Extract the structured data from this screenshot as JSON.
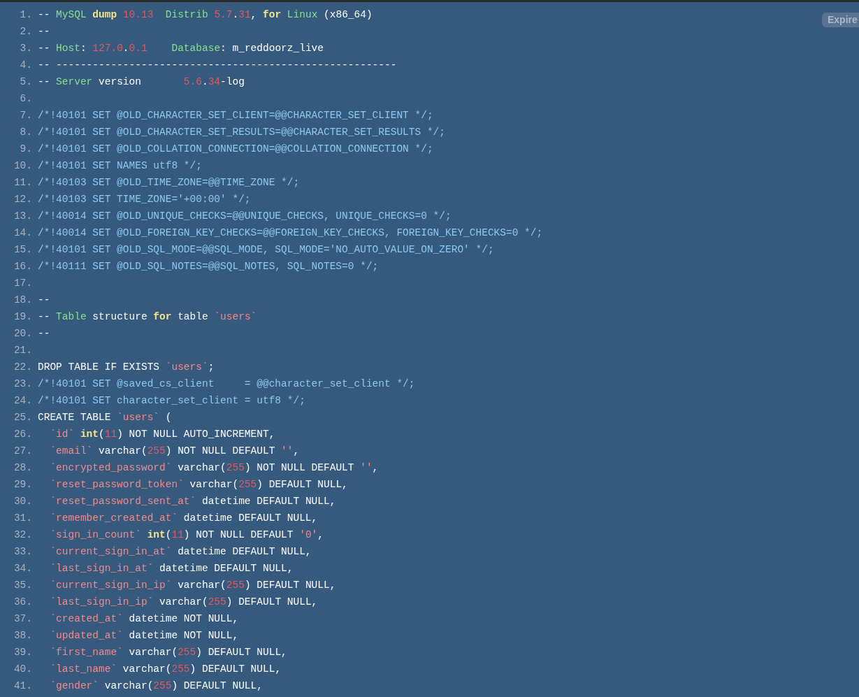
{
  "badge": "Expire",
  "lines": [
    {
      "number": "1.",
      "tokens": [
        {
          "kind": "plain",
          "text": "-- "
        },
        {
          "kind": "comment",
          "text": "MySQL "
        },
        {
          "kind": "keyword",
          "text": "dump "
        },
        {
          "kind": "number",
          "text": "10.13  "
        },
        {
          "kind": "comment",
          "text": "Distrib "
        },
        {
          "kind": "number",
          "text": "5.7"
        },
        {
          "kind": "plain",
          "text": "."
        },
        {
          "kind": "number",
          "text": "31"
        },
        {
          "kind": "plain",
          "text": ", "
        },
        {
          "kind": "keyword",
          "text": "for "
        },
        {
          "kind": "comment",
          "text": "Linux"
        },
        {
          "kind": "plain",
          "text": " (x86_64)"
        }
      ]
    },
    {
      "number": "2.",
      "tokens": [
        {
          "kind": "plain",
          "text": "--"
        }
      ]
    },
    {
      "number": "3.",
      "tokens": [
        {
          "kind": "plain",
          "text": "-- "
        },
        {
          "kind": "comment",
          "text": "Host"
        },
        {
          "kind": "plain",
          "text": ": "
        },
        {
          "kind": "number",
          "text": "127.0"
        },
        {
          "kind": "plain",
          "text": "."
        },
        {
          "kind": "number",
          "text": "0.1    "
        },
        {
          "kind": "comment",
          "text": "Database"
        },
        {
          "kind": "plain",
          "text": ": m_reddoorz_live"
        }
      ]
    },
    {
      "number": "4.",
      "tokens": [
        {
          "kind": "plain",
          "text": "-- --------------------------------------------------------"
        }
      ]
    },
    {
      "number": "5.",
      "tokens": [
        {
          "kind": "plain",
          "text": "-- "
        },
        {
          "kind": "comment",
          "text": "Server"
        },
        {
          "kind": "plain",
          "text": " version       "
        },
        {
          "kind": "number",
          "text": "5.6"
        },
        {
          "kind": "plain",
          "text": "."
        },
        {
          "kind": "number",
          "text": "34"
        },
        {
          "kind": "plain",
          "text": "-log"
        }
      ]
    },
    {
      "number": "6."
    },
    {
      "number": "7.",
      "tokens": [
        {
          "kind": "directive",
          "text": "/*!40101 SET @OLD_CHARACTER_SET_CLIENT=@@CHARACTER_SET_CLIENT */;"
        }
      ]
    },
    {
      "number": "8.",
      "tokens": [
        {
          "kind": "directive",
          "text": "/*!40101 SET @OLD_CHARACTER_SET_RESULTS=@@CHARACTER_SET_RESULTS */;"
        }
      ]
    },
    {
      "number": "9.",
      "tokens": [
        {
          "kind": "directive",
          "text": "/*!40101 SET @OLD_COLLATION_CONNECTION=@@COLLATION_CONNECTION */;"
        }
      ]
    },
    {
      "number": "10.",
      "tokens": [
        {
          "kind": "directive",
          "text": "/*!40101 SET NAMES utf8 */;"
        }
      ]
    },
    {
      "number": "11.",
      "tokens": [
        {
          "kind": "directive",
          "text": "/*!40103 SET @OLD_TIME_ZONE=@@TIME_ZONE */;"
        }
      ]
    },
    {
      "number": "12.",
      "tokens": [
        {
          "kind": "directive",
          "text": "/*!40103 SET TIME_ZONE='+00:00' */;"
        }
      ]
    },
    {
      "number": "13.",
      "tokens": [
        {
          "kind": "directive",
          "text": "/*!40014 SET @OLD_UNIQUE_CHECKS=@@UNIQUE_CHECKS, UNIQUE_CHECKS=0 */;"
        }
      ]
    },
    {
      "number": "14.",
      "tokens": [
        {
          "kind": "directive",
          "text": "/*!40014 SET @OLD_FOREIGN_KEY_CHECKS=@@FOREIGN_KEY_CHECKS, FOREIGN_KEY_CHECKS=0 */;"
        }
      ]
    },
    {
      "number": "15.",
      "tokens": [
        {
          "kind": "directive",
          "text": "/*!40101 SET @OLD_SQL_MODE=@@SQL_MODE, SQL_MODE='NO_AUTO_VALUE_ON_ZERO' */;"
        }
      ]
    },
    {
      "number": "16.",
      "tokens": [
        {
          "kind": "directive",
          "text": "/*!40111 SET @OLD_SQL_NOTES=@@SQL_NOTES, SQL_NOTES=0 */;"
        }
      ]
    },
    {
      "number": "17."
    },
    {
      "number": "18.",
      "tokens": [
        {
          "kind": "plain",
          "text": "--"
        }
      ]
    },
    {
      "number": "19.",
      "tokens": [
        {
          "kind": "plain",
          "text": "-- "
        },
        {
          "kind": "comment",
          "text": "Table"
        },
        {
          "kind": "plain",
          "text": " structure "
        },
        {
          "kind": "keyword",
          "text": "for"
        },
        {
          "kind": "plain",
          "text": " table "
        },
        {
          "kind": "string",
          "text": "`users`"
        }
      ]
    },
    {
      "number": "20.",
      "tokens": [
        {
          "kind": "plain",
          "text": "--"
        }
      ]
    },
    {
      "number": "21."
    },
    {
      "number": "22.",
      "tokens": [
        {
          "kind": "plain",
          "text": "DROP TABLE IF EXISTS "
        },
        {
          "kind": "string",
          "text": "`users`"
        },
        {
          "kind": "plain",
          "text": ";"
        }
      ]
    },
    {
      "number": "23.",
      "tokens": [
        {
          "kind": "directive",
          "text": "/*!40101 SET @saved_cs_client     = @@character_set_client */;"
        }
      ]
    },
    {
      "number": "24.",
      "tokens": [
        {
          "kind": "directive",
          "text": "/*!40101 SET character_set_client = utf8 */;"
        }
      ]
    },
    {
      "number": "25.",
      "tokens": [
        {
          "kind": "plain",
          "text": "CREATE TABLE "
        },
        {
          "kind": "string",
          "text": "`users`"
        },
        {
          "kind": "plain",
          "text": " ("
        }
      ]
    },
    {
      "number": "26.",
      "tokens": [
        {
          "kind": "string",
          "text": "  `id` "
        },
        {
          "kind": "keyword",
          "text": "int"
        },
        {
          "kind": "plain",
          "text": "("
        },
        {
          "kind": "number",
          "text": "11"
        },
        {
          "kind": "plain",
          "text": ") NOT NULL AUTO_INCREMENT,"
        }
      ]
    },
    {
      "number": "27.",
      "tokens": [
        {
          "kind": "string",
          "text": "  `email`"
        },
        {
          "kind": "plain",
          "text": " varchar("
        },
        {
          "kind": "number",
          "text": "255"
        },
        {
          "kind": "plain",
          "text": ") NOT NULL DEFAULT "
        },
        {
          "kind": "string",
          "text": "''"
        },
        {
          "kind": "plain",
          "text": ","
        }
      ]
    },
    {
      "number": "28.",
      "tokens": [
        {
          "kind": "string",
          "text": "  `encrypted_password`"
        },
        {
          "kind": "plain",
          "text": " varchar("
        },
        {
          "kind": "number",
          "text": "255"
        },
        {
          "kind": "plain",
          "text": ") NOT NULL DEFAULT "
        },
        {
          "kind": "string",
          "text": "''"
        },
        {
          "kind": "plain",
          "text": ","
        }
      ]
    },
    {
      "number": "29.",
      "tokens": [
        {
          "kind": "string",
          "text": "  `reset_password_token`"
        },
        {
          "kind": "plain",
          "text": " varchar("
        },
        {
          "kind": "number",
          "text": "255"
        },
        {
          "kind": "plain",
          "text": ") DEFAULT NULL,"
        }
      ]
    },
    {
      "number": "30.",
      "tokens": [
        {
          "kind": "string",
          "text": "  `reset_password_sent_at`"
        },
        {
          "kind": "plain",
          "text": " datetime DEFAULT NULL,"
        }
      ]
    },
    {
      "number": "31.",
      "tokens": [
        {
          "kind": "string",
          "text": "  `remember_created_at`"
        },
        {
          "kind": "plain",
          "text": " datetime DEFAULT NULL,"
        }
      ]
    },
    {
      "number": "32.",
      "tokens": [
        {
          "kind": "string",
          "text": "  `sign_in_count` "
        },
        {
          "kind": "keyword",
          "text": "int"
        },
        {
          "kind": "plain",
          "text": "("
        },
        {
          "kind": "number",
          "text": "11"
        },
        {
          "kind": "plain",
          "text": ") NOT NULL DEFAULT "
        },
        {
          "kind": "string",
          "text": "'0'"
        },
        {
          "kind": "plain",
          "text": ","
        }
      ]
    },
    {
      "number": "33.",
      "tokens": [
        {
          "kind": "string",
          "text": "  `current_sign_in_at`"
        },
        {
          "kind": "plain",
          "text": " datetime DEFAULT NULL,"
        }
      ]
    },
    {
      "number": "34.",
      "tokens": [
        {
          "kind": "string",
          "text": "  `last_sign_in_at`"
        },
        {
          "kind": "plain",
          "text": " datetime DEFAULT NULL,"
        }
      ]
    },
    {
      "number": "35.",
      "tokens": [
        {
          "kind": "string",
          "text": "  `current_sign_in_ip`"
        },
        {
          "kind": "plain",
          "text": " varchar("
        },
        {
          "kind": "number",
          "text": "255"
        },
        {
          "kind": "plain",
          "text": ") DEFAULT NULL,"
        }
      ]
    },
    {
      "number": "36.",
      "tokens": [
        {
          "kind": "string",
          "text": "  `last_sign_in_ip`"
        },
        {
          "kind": "plain",
          "text": " varchar("
        },
        {
          "kind": "number",
          "text": "255"
        },
        {
          "kind": "plain",
          "text": ") DEFAULT NULL,"
        }
      ]
    },
    {
      "number": "37.",
      "tokens": [
        {
          "kind": "string",
          "text": "  `created_at`"
        },
        {
          "kind": "plain",
          "text": " datetime NOT NULL,"
        }
      ]
    },
    {
      "number": "38.",
      "tokens": [
        {
          "kind": "string",
          "text": "  `updated_at`"
        },
        {
          "kind": "plain",
          "text": " datetime NOT NULL,"
        }
      ]
    },
    {
      "number": "39.",
      "tokens": [
        {
          "kind": "string",
          "text": "  `first_name`"
        },
        {
          "kind": "plain",
          "text": " varchar("
        },
        {
          "kind": "number",
          "text": "255"
        },
        {
          "kind": "plain",
          "text": ") DEFAULT NULL,"
        }
      ]
    },
    {
      "number": "40.",
      "tokens": [
        {
          "kind": "string",
          "text": "  `last_name`"
        },
        {
          "kind": "plain",
          "text": " varchar("
        },
        {
          "kind": "number",
          "text": "255"
        },
        {
          "kind": "plain",
          "text": ") DEFAULT NULL,"
        }
      ]
    },
    {
      "number": "41.",
      "tokens": [
        {
          "kind": "string",
          "text": "  `gender`"
        },
        {
          "kind": "plain",
          "text": " varchar("
        },
        {
          "kind": "number",
          "text": "255"
        },
        {
          "kind": "plain",
          "text": ") DEFAULT NULL,"
        }
      ]
    }
  ]
}
